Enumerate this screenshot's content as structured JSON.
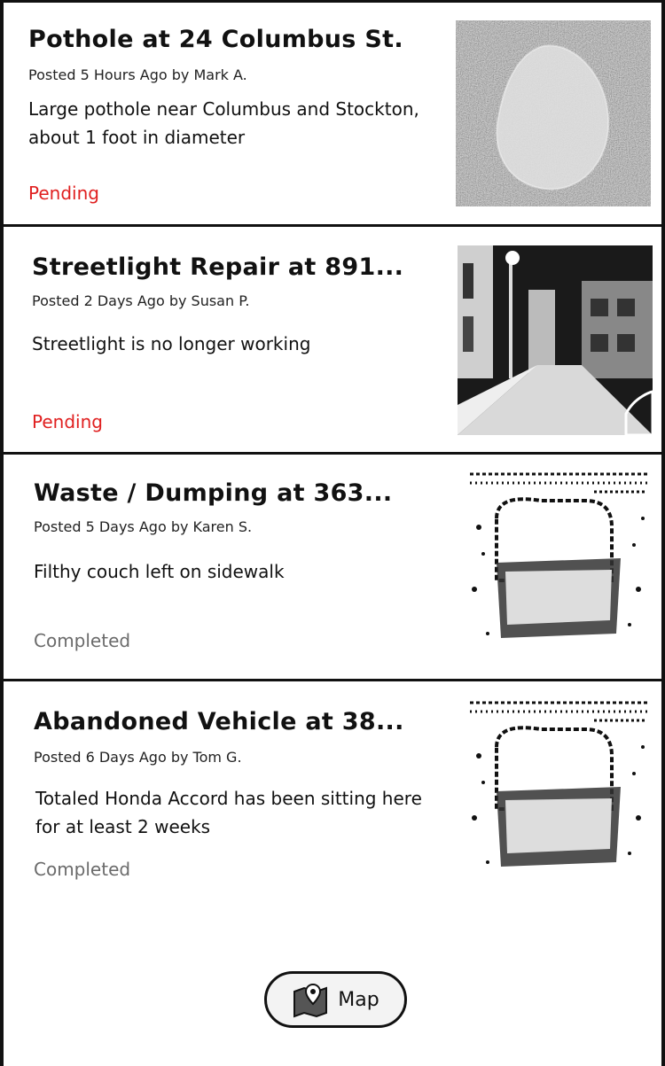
{
  "reports": [
    {
      "title": "Pothole at 24 Columbus St.",
      "meta": "Posted 5 Hours Ago by Mark A.",
      "description": "Large pothole near Columbus and Stockton, about 1 foot in diameter",
      "status": "Pending",
      "image": "pothole-photo"
    },
    {
      "title": "Streetlight Repair at 891...",
      "meta": "Posted 2 Days Ago by Susan P.",
      "description": "Streetlight is no longer working",
      "status": "Pending",
      "image": "streetlight-photo"
    },
    {
      "title": "Waste / Dumping at 363...",
      "meta": "Posted 5 Days Ago by Karen S.",
      "description": "Filthy couch left on sidewalk",
      "status": "Completed",
      "image": "couch-photo"
    },
    {
      "title": "Abandoned Vehicle at 38...",
      "meta": "Posted 6 Days Ago by Tom G.",
      "description": "Totaled Honda Accord has been sitting here for at least 2 weeks",
      "status": "Completed",
      "image": "couch-photo"
    }
  ],
  "map_button": {
    "label": "Map",
    "icon": "map-pin-icon"
  },
  "colors": {
    "pending": "#e02020",
    "completed": "#6b6b6b"
  }
}
